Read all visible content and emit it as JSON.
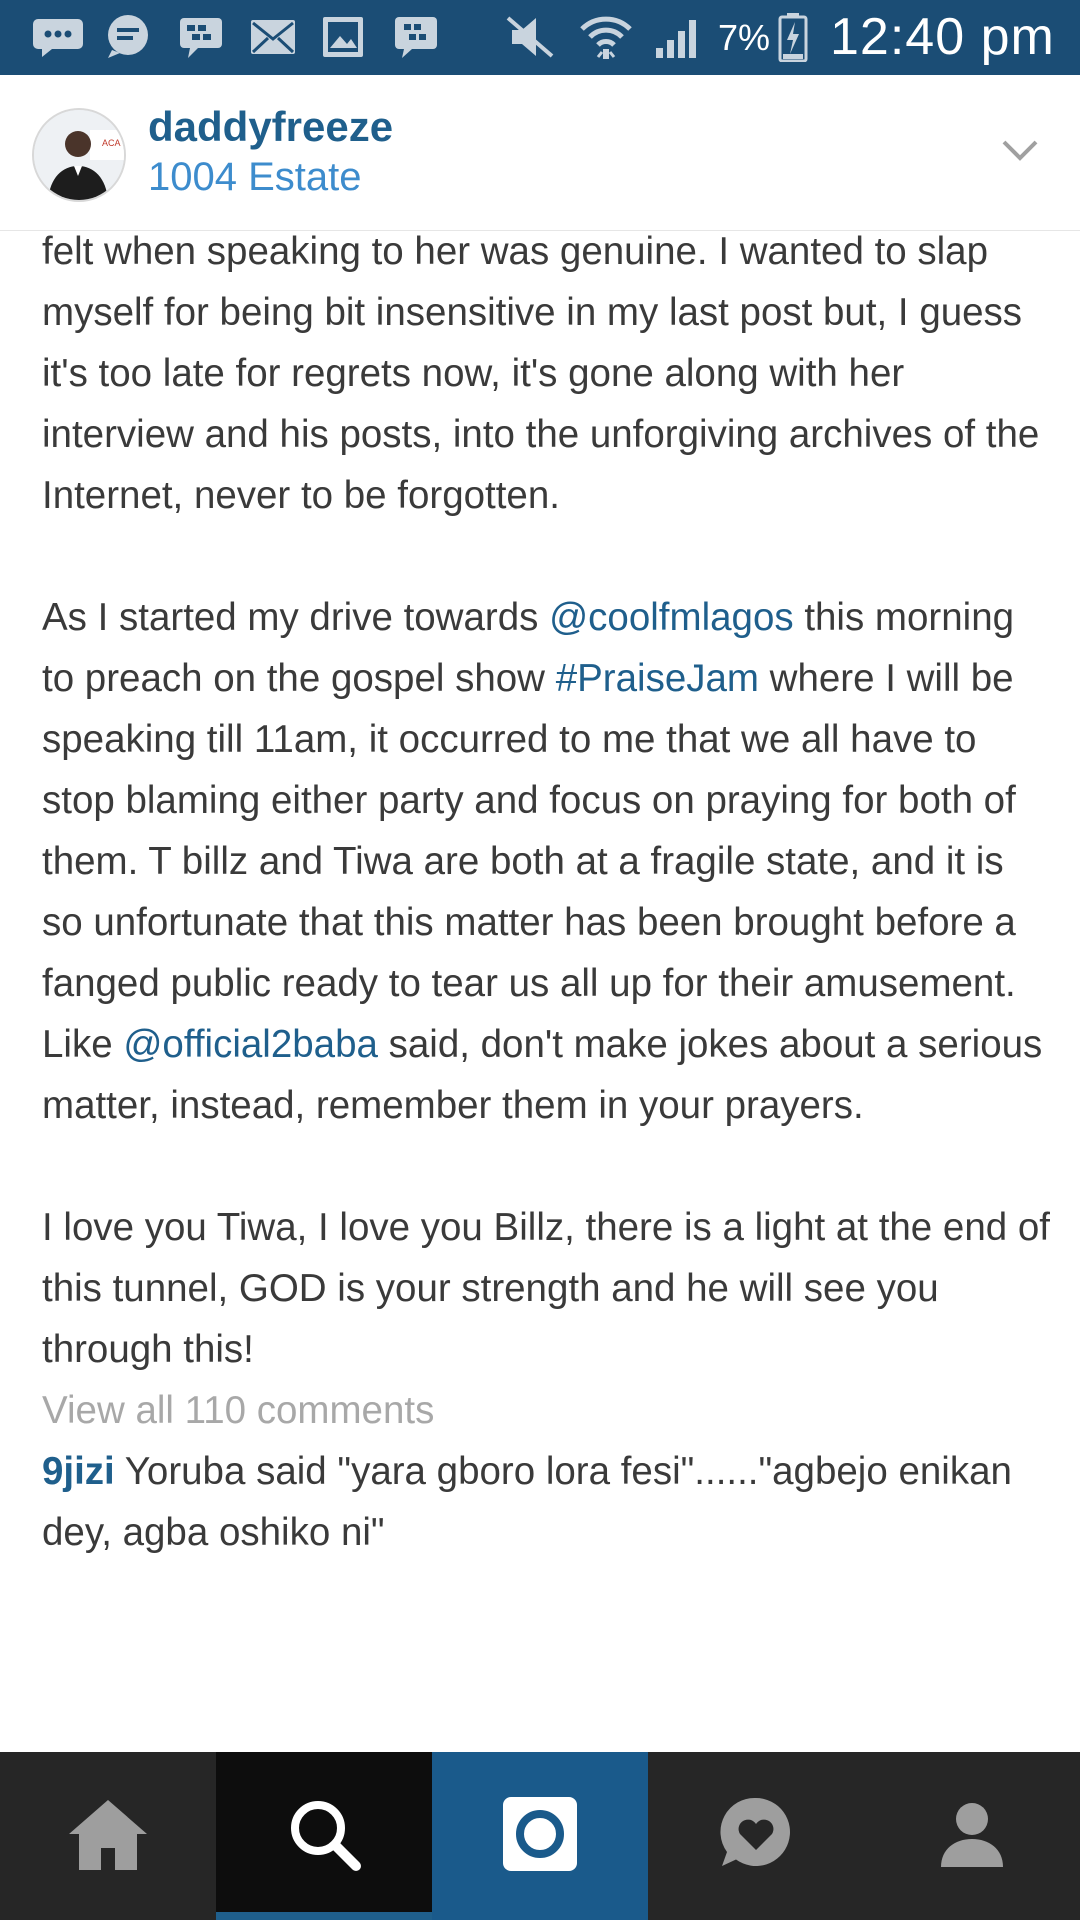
{
  "status_bar": {
    "battery_percent": "7%",
    "time": "12:40 pm",
    "icons": [
      "chat-bubble-dots-icon",
      "message-icon",
      "bbm-chat-icon",
      "email-icon",
      "gallery-icon",
      "bbm-icon",
      "mute-icon",
      "wifi-icon",
      "signal-icon",
      "battery-charging-icon"
    ]
  },
  "post": {
    "username": "daddyfreeze",
    "location": "1004 Estate",
    "avatar_icon": "profile-photo",
    "menu_icon": "chevron-down-icon"
  },
  "caption": {
    "p1": "for, it's the fact that I am a good judge of character. What I felt when speaking to her was genuine. I wanted to slap myself for being bit insensitive in my last post but, I guess it's too late for regrets now, it's gone along with her interview and his posts, into the unforgiving archives of the Internet, never to be forgotten.",
    "p2_a": "As I started my drive towards ",
    "p2_link1": "@coolfmlagos",
    "p2_b": " this morning to preach on the gospel show ",
    "p2_link2": "#PraiseJam",
    "p2_c": " where I will be speaking till 11am, it occurred to me that we all have to stop blaming either party and focus on praying for both of them. T billz and Tiwa are both at a fragile state, and it is so unfortunate that this matter has been brought before a fanged public ready to tear us all up for their amusement. Like ",
    "p2_link3": "@official2baba",
    "p2_d": " said, don't make jokes about a serious matter, instead, remember them in your prayers.",
    "p3": "I love you Tiwa, I love you Billz, there is a light at the end of this tunnel, GOD is your strength and he will see you through this!"
  },
  "comments": {
    "view_all": "View all 110 comments",
    "first": {
      "user": "9jizi",
      "text": " Yoruba said \"yara gboro lora fesi\"......\"agbejo enikan dey, agba oshiko ni\""
    }
  },
  "bottom_nav": {
    "items": [
      "home-icon",
      "search-icon",
      "camera-icon",
      "activity-icon",
      "profile-icon"
    ],
    "active": "search",
    "accent_color": "#1f5f8c"
  },
  "colors": {
    "status_bar": "#1b4d75",
    "link": "#1f5f8c",
    "location": "#3d8ccd",
    "nav_background": "#262626"
  }
}
